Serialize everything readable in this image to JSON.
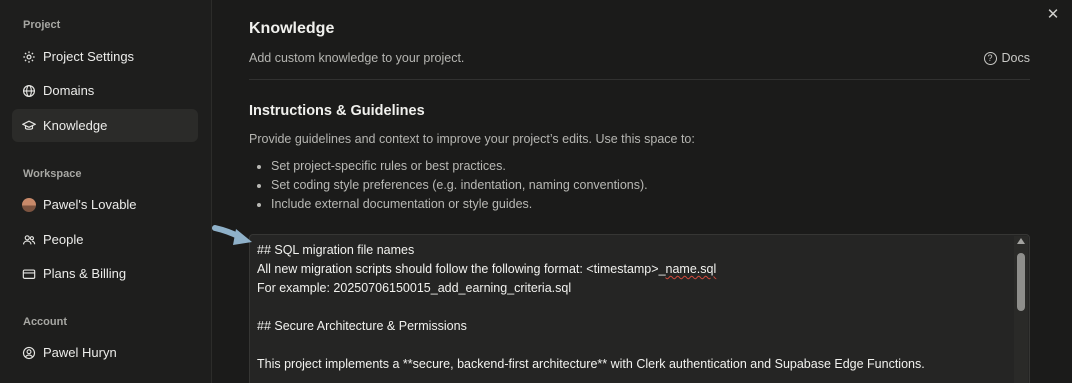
{
  "sidebar": {
    "project_section": "Project",
    "workspace_section": "Workspace",
    "account_section": "Account",
    "items": [
      {
        "label": "Project Settings",
        "icon": "gear-icon"
      },
      {
        "label": "Domains",
        "icon": "globe-icon"
      },
      {
        "label": "Knowledge",
        "icon": "graduation-cap-icon",
        "active": true
      },
      {
        "label": "Pawel's Lovable",
        "icon": "avatar"
      },
      {
        "label": "People",
        "icon": "people-icon"
      },
      {
        "label": "Plans & Billing",
        "icon": "credit-card-icon"
      },
      {
        "label": "Pawel Huryn",
        "icon": "user-circle-icon"
      }
    ]
  },
  "header": {
    "title": "Knowledge",
    "subtitle": "Add custom knowledge to your project.",
    "docs_label": "Docs",
    "close_glyph": "✕"
  },
  "instructions": {
    "heading": "Instructions & Guidelines",
    "description": "Provide guidelines and context to improve your project’s edits. Use this space to:",
    "bullets": [
      "Set project-specific rules or best practices.",
      "Set coding style preferences (e.g. indentation, naming conventions).",
      "Include external documentation or style guides."
    ]
  },
  "editor": {
    "lines": [
      "## SQL migration file names",
      "All new migration scripts should follow the following format: <timestamp>_",
      "name.sql",
      "For example: 20250706150015_add_earning_criteria.sql",
      "## Secure Architecture & Permissions",
      "This project implements a **secure, backend-first architecture** with Clerk authentication and Supabase Edge Functions."
    ]
  },
  "colors": {
    "background": "#1b1b1a",
    "sidebar": "#1e1e1d",
    "active_item": "#2b2b29",
    "editor_bg": "#252524",
    "annotation_arrow": "#8fb1c9",
    "spellcheck": "#d04a3d"
  }
}
